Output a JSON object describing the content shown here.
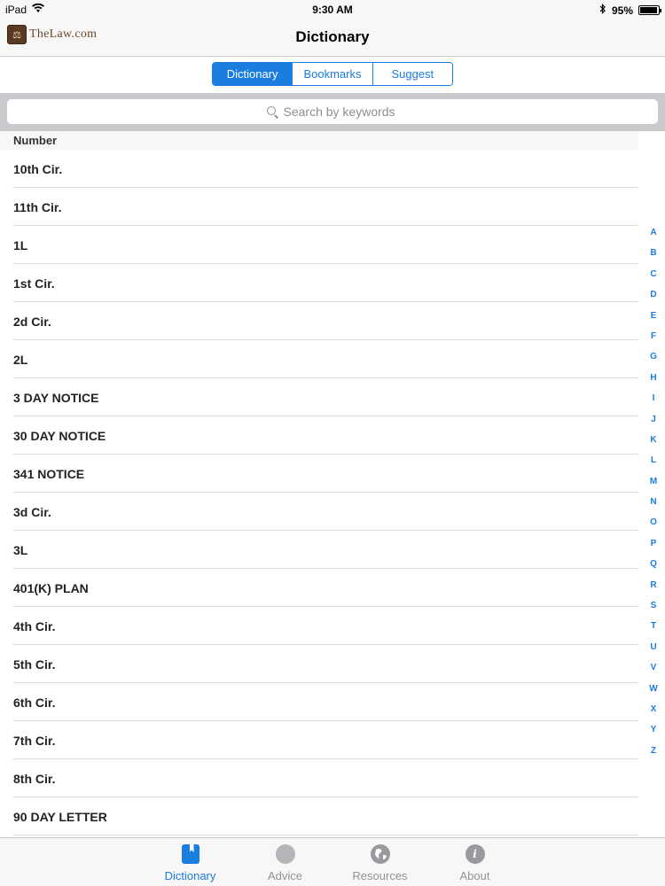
{
  "status_bar": {
    "device": "iPad",
    "time": "9:30 AM",
    "battery": "95%",
    "battery_level": 0.95
  },
  "nav": {
    "logo_text": "TheLaw.com",
    "title": "Dictionary"
  },
  "segments": [
    {
      "label": "Dictionary",
      "active": true
    },
    {
      "label": "Bookmarks",
      "active": false
    },
    {
      "label": "Suggest",
      "active": false
    }
  ],
  "search": {
    "placeholder": "Search by keywords"
  },
  "list": {
    "section": "Number",
    "rows": [
      "10th Cir.",
      "11th Cir.",
      "1L",
      "1st Cir.",
      "2d Cir.",
      "2L",
      "3 DAY NOTICE",
      "30 DAY NOTICE",
      "341 NOTICE",
      "3d Cir.",
      "3L",
      "401(K) PLAN",
      "4th Cir.",
      "5th Cir.",
      "6th Cir.",
      "7th Cir.",
      "8th Cir.",
      "90 DAY LETTER"
    ]
  },
  "index": [
    "A",
    "B",
    "C",
    "D",
    "E",
    "F",
    "G",
    "H",
    "I",
    "J",
    "K",
    "L",
    "M",
    "N",
    "O",
    "P",
    "Q",
    "R",
    "S",
    "T",
    "U",
    "V",
    "W",
    "X",
    "Y",
    "Z"
  ],
  "tabs": [
    {
      "label": "Dictionary",
      "icon": "book-icon",
      "active": true
    },
    {
      "label": "Advice",
      "icon": "lightbulb-icon",
      "active": false
    },
    {
      "label": "Resources",
      "icon": "globe-icon",
      "active": false
    },
    {
      "label": "About",
      "icon": "info-icon",
      "active": false
    }
  ],
  "colors": {
    "accent": "#1a7de0",
    "bar_bg": "#f7f7f7",
    "search_bg": "#c9c9ce"
  }
}
